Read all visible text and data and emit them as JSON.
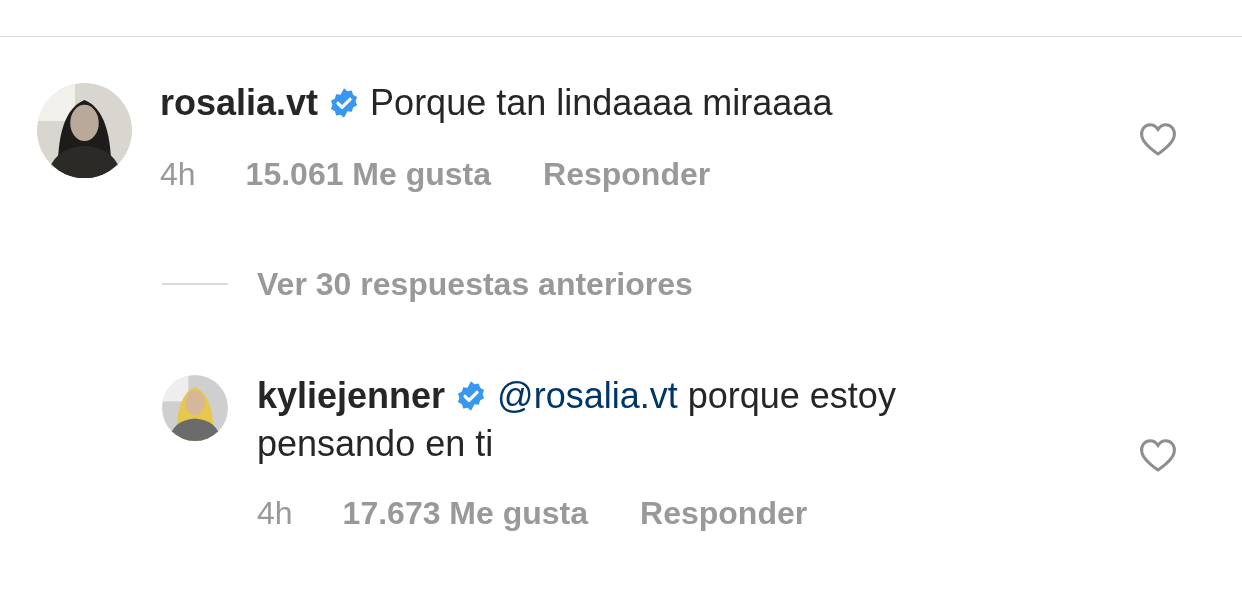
{
  "comments": [
    {
      "username": "rosalia.vt",
      "verified": true,
      "text": "Porque tan lindaaaa miraaaa",
      "time": "4h",
      "likes": "15.061 Me gusta",
      "reply_label": "Responder",
      "liked": false
    }
  ],
  "view_replies": {
    "label": "Ver 30 respuestas anteriores"
  },
  "replies": [
    {
      "username": "kyliejenner",
      "verified": true,
      "mention": "@rosalia.vt",
      "text": "porque estoy pensando en ti",
      "time": "4h",
      "likes": "17.673 Me gusta",
      "reply_label": "Responder",
      "liked": false
    }
  ]
}
